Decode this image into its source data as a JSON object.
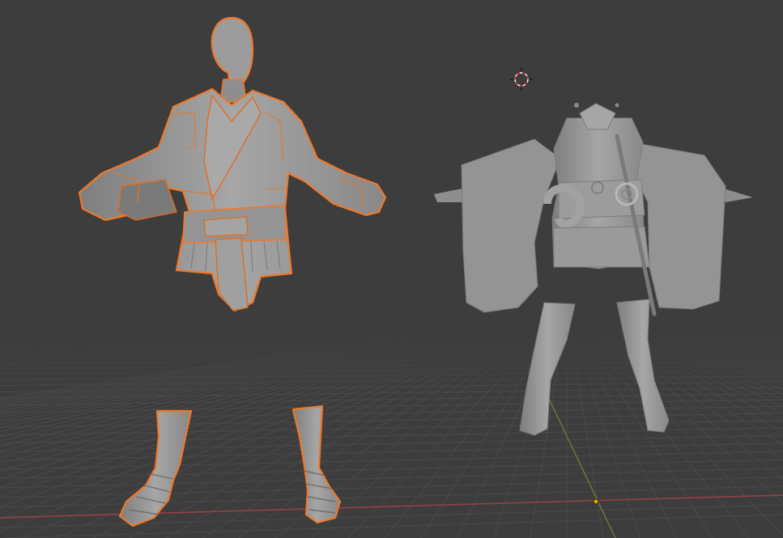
{
  "viewport": {
    "background_color": "#3d3d3d",
    "grid_color": "#4a4a4a",
    "x_axis_color": "#9a3e48",
    "y_axis_color": "#6a8a2e",
    "selection_outline_color": "#f07828",
    "mesh_color": "#9a9a9a"
  },
  "icons": {
    "cursor": "3d-cursor-icon",
    "origin": "object-origin-icon"
  },
  "objects": [
    {
      "name": "kimono-top",
      "selected": true
    },
    {
      "name": "sandal-boot-left",
      "selected": true
    },
    {
      "name": "sandal-boot-right",
      "selected": true
    },
    {
      "name": "character-body-kimono",
      "selected": false
    },
    {
      "name": "katana",
      "selected": false
    }
  ]
}
